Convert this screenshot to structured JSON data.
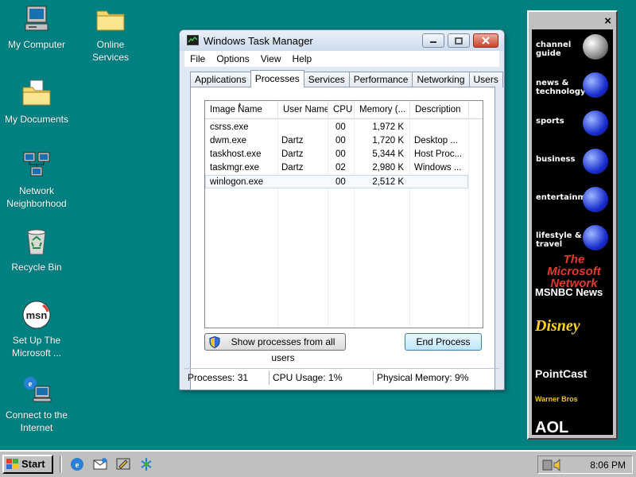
{
  "desktop": {
    "icons": [
      {
        "label_lines": [
          "My Computer"
        ]
      },
      {
        "label_lines": [
          "Online",
          "Services"
        ]
      },
      {
        "label_lines": [
          "My Documents"
        ]
      },
      {
        "label_lines": [
          "Network",
          "Neighborhood"
        ]
      },
      {
        "label_lines": [
          "Recycle Bin"
        ]
      },
      {
        "label_lines": [
          "Set Up The",
          "Microsoft ..."
        ]
      },
      {
        "label_lines": [
          "Connect to the",
          "Internet"
        ]
      }
    ]
  },
  "window": {
    "title": "Windows Task Manager",
    "menu": [
      "File",
      "Options",
      "View",
      "Help"
    ],
    "tabs": [
      "Applications",
      "Processes",
      "Services",
      "Performance",
      "Networking",
      "Users"
    ],
    "active_tab": "Processes",
    "columns": [
      "Image Name",
      "User Name",
      "CPU",
      "Memory (...",
      "Description"
    ],
    "processes": [
      {
        "image": "csrss.exe",
        "user": "",
        "cpu": "00",
        "memory": "1,972 K",
        "description": ""
      },
      {
        "image": "dwm.exe",
        "user": "Dartz",
        "cpu": "00",
        "memory": "1,720 K",
        "description": "Desktop ..."
      },
      {
        "image": "taskhost.exe",
        "user": "Dartz",
        "cpu": "00",
        "memory": "5,344 K",
        "description": "Host Proc..."
      },
      {
        "image": "taskmgr.exe",
        "user": "Dartz",
        "cpu": "02",
        "memory": "2,980 K",
        "description": "Windows ..."
      },
      {
        "image": "winlogon.exe",
        "user": "",
        "cpu": "00",
        "memory": "2,512 K",
        "description": ""
      }
    ],
    "selected_process": "winlogon.exe",
    "show_all_label": "Show processes from all users",
    "end_process_label": "End Process",
    "status": {
      "processes": "Processes: 31",
      "cpu": "CPU Usage: 1%",
      "memory": "Physical Memory: 9%"
    }
  },
  "channel_bar": {
    "close_glyph": "×",
    "channels": [
      "channel guide",
      "news & technology",
      "sports",
      "business",
      "entertainment",
      "lifestyle & travel"
    ],
    "brands": [
      "The Microsoft Network",
      "MSNBC News",
      "Disney",
      "PointCast",
      "Warner Bros",
      "AOL"
    ]
  },
  "taskbar": {
    "start_label": "Start",
    "clock": "8:06 PM"
  },
  "colors": {
    "desktop": "#008080",
    "taskbar": "#c0c0c0",
    "window_frame": "#dfe8f3",
    "close_button": "#c8442c"
  }
}
